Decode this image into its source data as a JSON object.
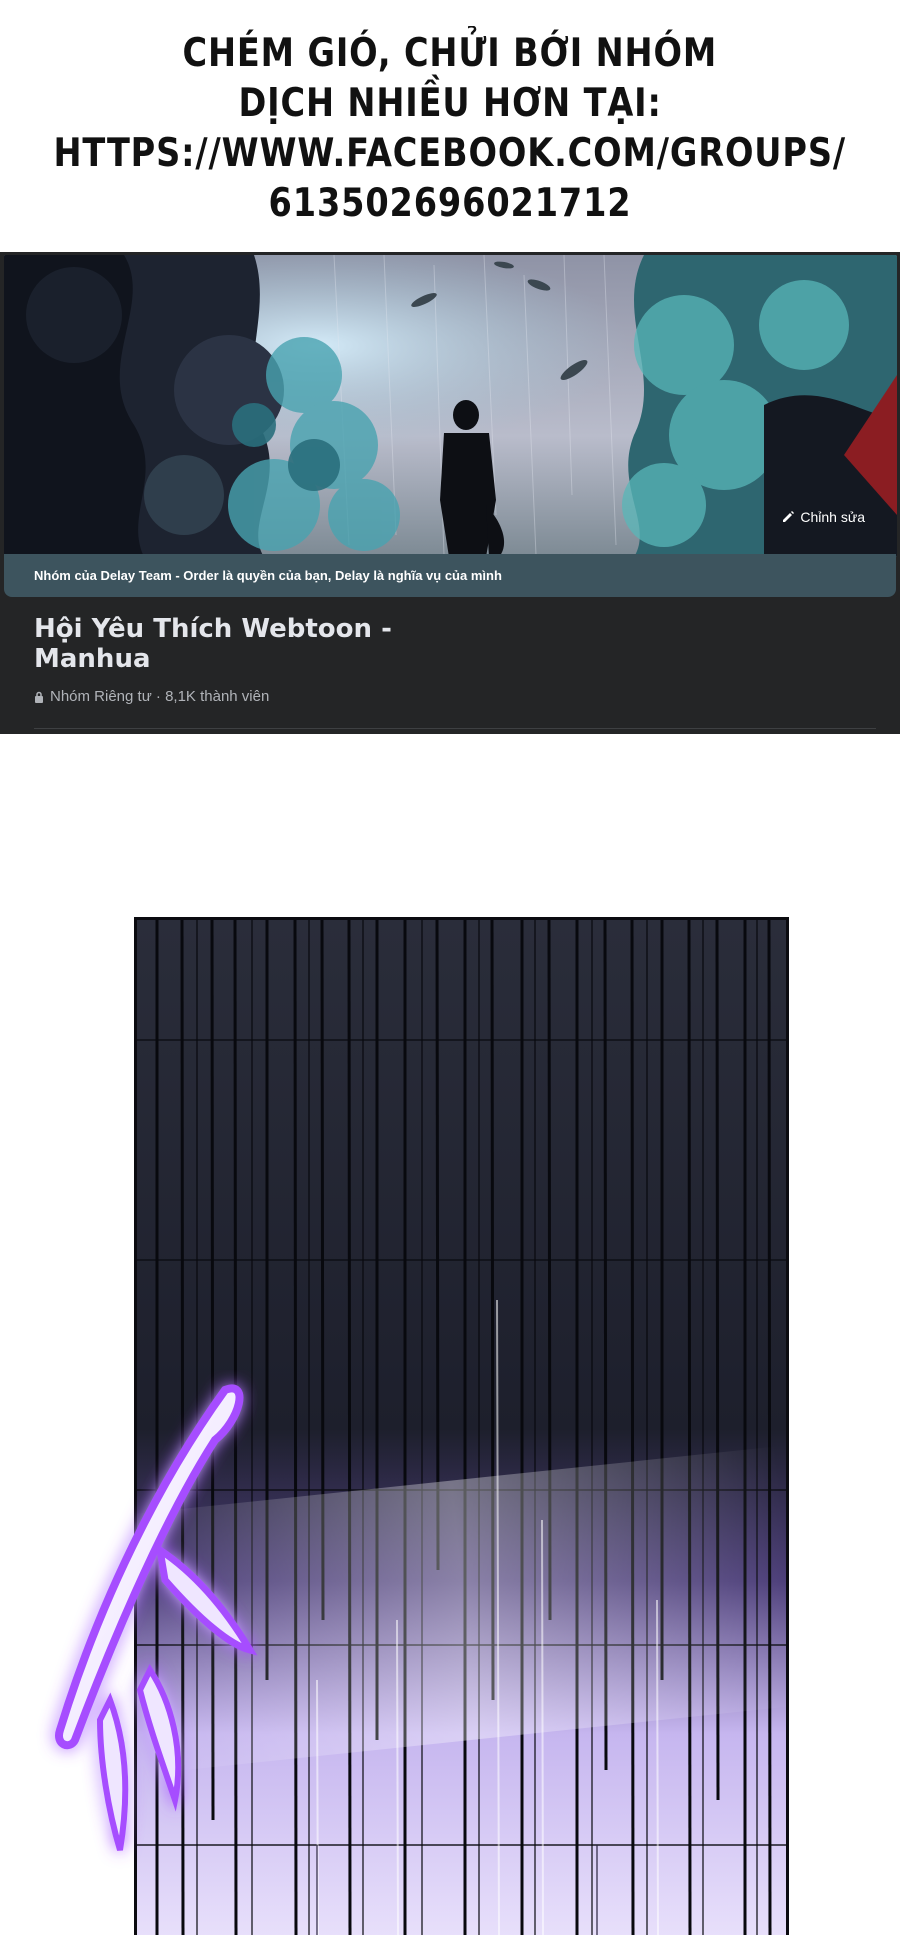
{
  "promo": {
    "lines": [
      "CHÉM GIÓ, CHỬI BỚI NHÓM",
      "DỊCH NHIỀU HƠN TẠI:",
      "HTTPS://WWW.FACEBOOK.COM/GROUPS/",
      "613502696021712"
    ]
  },
  "group": {
    "edit_label": "Chỉnh sửa",
    "banner_text": "Nhóm của Delay Team - Order là quyền của bạn, Delay là nghĩa vụ của mình",
    "name_line1": "Hội Yêu Thích Webtoon -",
    "name_line2": "Manhua",
    "meta": "Nhóm Riêng tư · 8,1K thành viên"
  },
  "icons": {
    "edit": "pencil-icon",
    "privacy": "lock-icon"
  },
  "colors": {
    "card_bg": "#242526",
    "banner_bg": "#3d545e",
    "glow": "#a64dff"
  }
}
